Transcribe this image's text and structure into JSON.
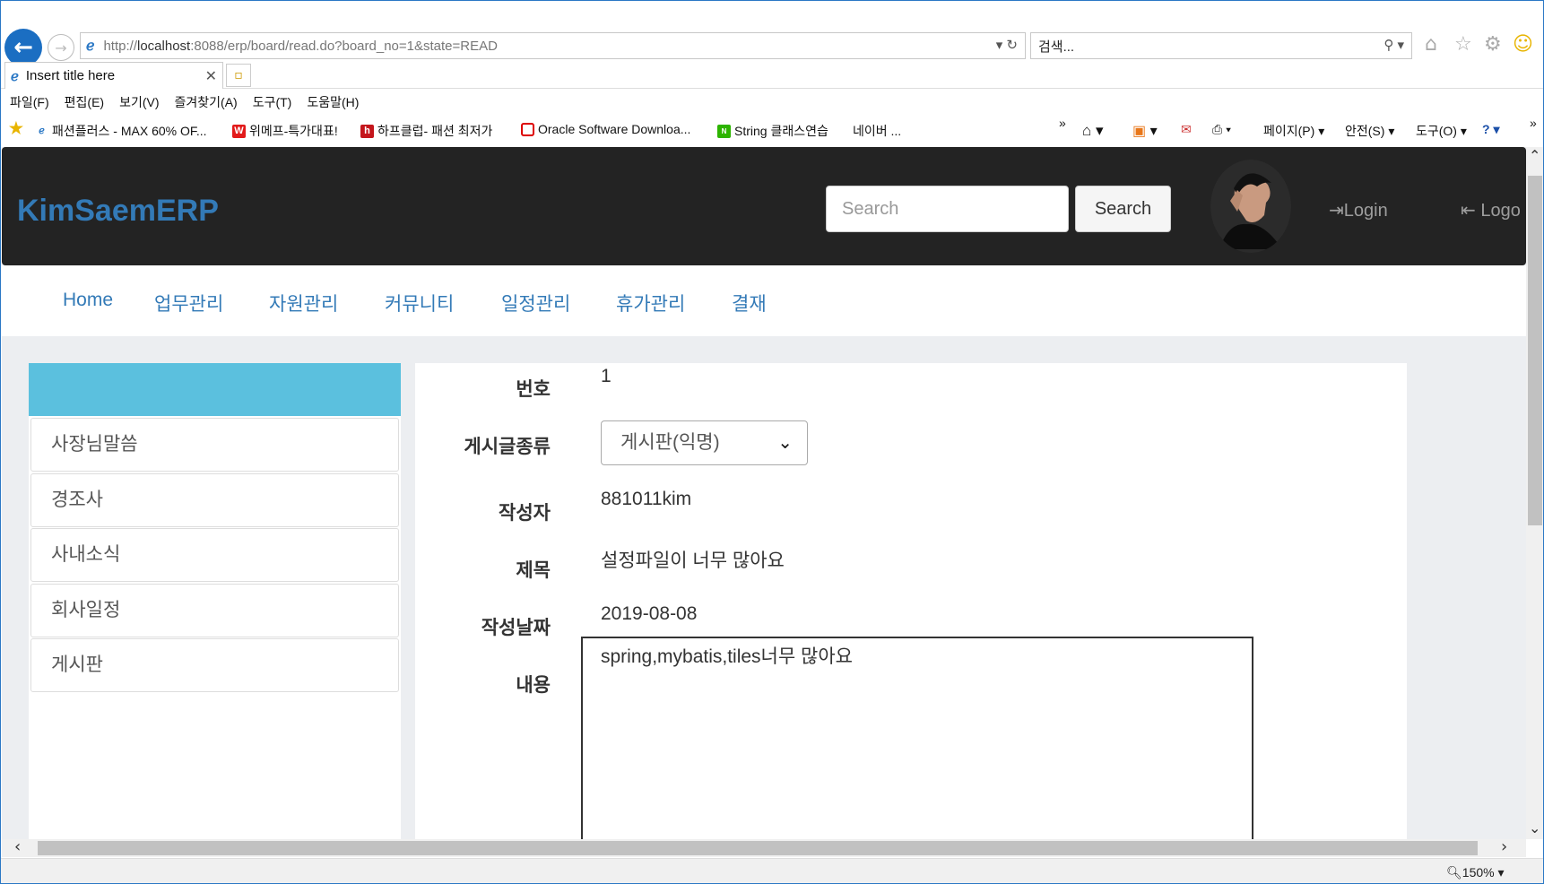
{
  "browser": {
    "url_prefix": "http://",
    "url_host": "localhost",
    "url_rest": ":8088/erp/board/read.do?board_no=1&state=READ",
    "search_placeholder": "검색...",
    "tab_title": "Insert title here",
    "menu": [
      "파일(F)",
      "편집(E)",
      "보기(V)",
      "즐겨찾기(A)",
      "도구(T)",
      "도움말(H)"
    ],
    "favorites": [
      {
        "label": "패션플러스 - MAX 60% OF...",
        "icon": "e"
      },
      {
        "label": "위메프-특가대표!",
        "icon": "W",
        "color": "#e21a1a"
      },
      {
        "label": "하프클럽- 패션 최저가",
        "icon": "h",
        "color": "#c4161c"
      },
      {
        "label": "Oracle Software Downloa...",
        "icon": "O",
        "color": "#d00"
      },
      {
        "label": "String 클래스연습",
        "icon": "N",
        "color": "#2db400"
      },
      {
        "label": "네이버 ..."
      }
    ],
    "commands": [
      "페이지(P)",
      "안전(S)",
      "도구(O)"
    ],
    "zoom": "150%",
    "more": "»"
  },
  "navbar": {
    "brand": "KimSaemERP",
    "search_placeholder": "Search",
    "search_button": "Search",
    "login": "Login",
    "logout": "Logo"
  },
  "main_tabs": [
    "Home",
    "업무관리",
    "자원관리",
    "커뮤니티",
    "일정관리",
    "휴가관리",
    "결재"
  ],
  "sidebar": {
    "items": [
      "사장님말씀",
      "경조사",
      "사내소식",
      "회사일정",
      "게시판"
    ]
  },
  "form": {
    "no_label": "번호",
    "no_value": "1",
    "type_label": "게시글종류",
    "type_value": "게시판(익명)",
    "writer_label": "작성자",
    "writer_value": "881011kim",
    "title_label": "제목",
    "title_value": "설정파일이 너무 많아요",
    "date_label": "작성날짜",
    "date_value": "2019-08-08",
    "content_label": "내용",
    "content_value": "spring,mybatis,tiles너무 많아요"
  }
}
